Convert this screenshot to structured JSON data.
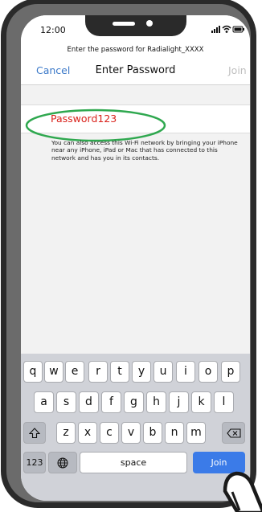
{
  "status": {
    "time": "12:00"
  },
  "header": {
    "subtitle": "Enter the password for Radialight_XXXX",
    "cancel": "Cancel",
    "title": "Enter Password",
    "join": "Join"
  },
  "password_field": {
    "value": "Password123"
  },
  "help_text": "You can also access this Wi-Fi network by bringing your iPhone near any iPhone, iPad or Mac that has connected to this network and has you in its contacts.",
  "keyboard": {
    "row1": [
      "q",
      "w",
      "e",
      "r",
      "t",
      "y",
      "u",
      "i",
      "o",
      "p"
    ],
    "row2": [
      "a",
      "s",
      "d",
      "f",
      "g",
      "h",
      "j",
      "k",
      "l"
    ],
    "row3": [
      "z",
      "x",
      "c",
      "v",
      "b",
      "n",
      "m"
    ],
    "numbers": "123",
    "space": "space",
    "join": "Join"
  },
  "colors": {
    "accent": "#3a78c8",
    "password": "#d9221b",
    "join_key": "#3b7be8",
    "highlight": "#2fa84f"
  }
}
